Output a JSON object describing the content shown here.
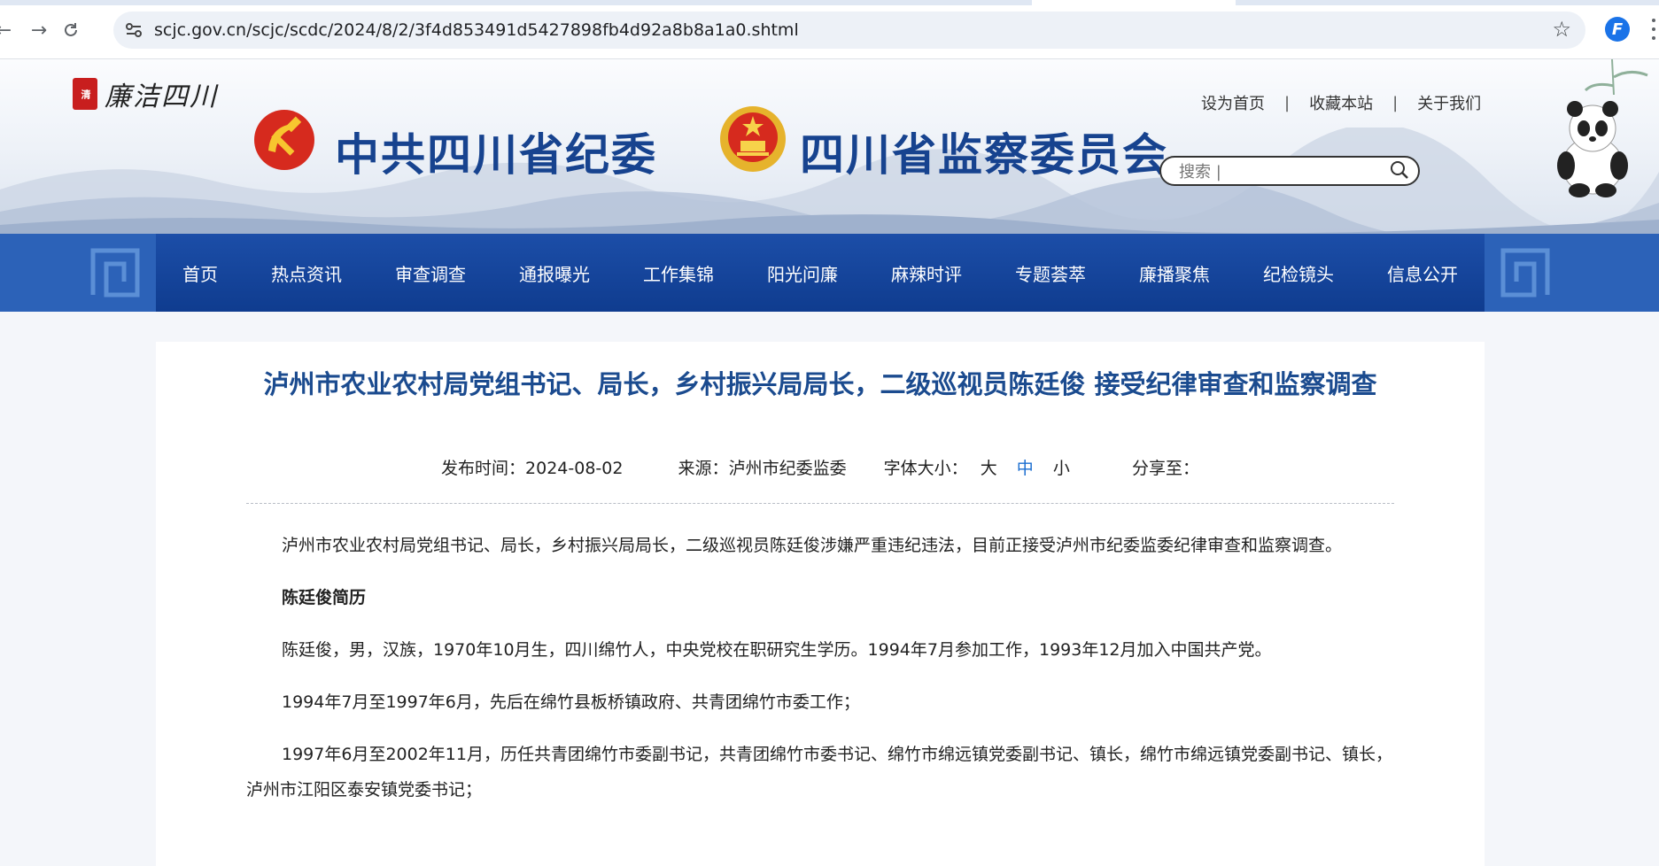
{
  "browser": {
    "url": "scjc.gov.cn/scjc/scdc/2024/8/2/3f4d853491d5427898fb4d92a8b8a1a0.shtml",
    "back_icon": "back-arrow-icon",
    "forward_icon": "forward-arrow-icon",
    "reload_icon": "reload-icon",
    "bookmark_icon": "star-icon"
  },
  "header": {
    "small_logo_seal": "清",
    "small_logo_text": "廉洁四川",
    "title_party": "中共四川省纪委",
    "title_state": "四川省监察委员会",
    "links": [
      "设为首页",
      "收藏本站",
      "关于我们"
    ],
    "link_separator": "|",
    "search_placeholder": "搜索 |"
  },
  "nav": {
    "items": [
      "首页",
      "热点资讯",
      "审查调查",
      "通报曝光",
      "工作集锦",
      "阳光问廉",
      "麻辣时评",
      "专题荟萃",
      "廉播聚焦",
      "纪检镜头",
      "信息公开"
    ]
  },
  "article": {
    "title": "泸州市农业农村局党组书记、局长，乡村振兴局局长，二级巡视员陈廷俊 接受纪律审查和监察调查",
    "publish_label": "发布时间：",
    "publish_date": "2024-08-02",
    "source_label": "来源：",
    "source": "泸州市纪委监委",
    "font_size_label": "字体大小：",
    "font_sizes": [
      "大",
      "中",
      "小"
    ],
    "share_label": "分享至：",
    "paragraphs": [
      "泸州市农业农村局党组书记、局长，乡村振兴局局长，二级巡视员陈廷俊涉嫌严重违纪违法，目前正接受泸州市纪委监委纪律审查和监察调查。",
      "陈廷俊简历",
      "陈廷俊，男，汉族，1970年10月生，四川绵竹人，中央党校在职研究生学历。1994年7月参加工作，1993年12月加入中国共产党。",
      "1994年7月至1997年6月，先后在绵竹县板桥镇政府、共青团绵竹市委工作；",
      "1997年6月至2002年11月，历任共青团绵竹市委副书记，共青团绵竹市委书记、绵竹市绵远镇党委副书记、镇长，绵竹市绵远镇党委副书记、镇长，泸州市江阳区泰安镇党委书记；"
    ]
  },
  "colors": {
    "title_blue": "#17438f",
    "nav_blue": "#0f3c8f",
    "article_title": "#1b4b8f",
    "active_font_size": "#1b6ed0"
  }
}
